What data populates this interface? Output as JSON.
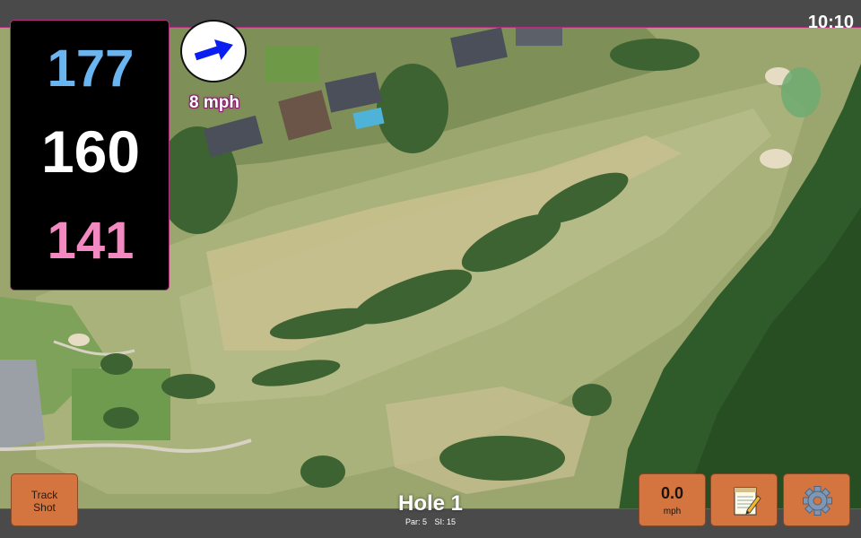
{
  "status": {
    "time": "10:10"
  },
  "distances": {
    "back": "177",
    "center": "160",
    "front": "141"
  },
  "wind": {
    "speed_text": "8 mph",
    "icon": "wind-arrow-icon",
    "arrow_color": "#0a1ef2"
  },
  "hole": {
    "title": "Hole 1",
    "par": "Par: 5",
    "stroke_index": "SI: 15"
  },
  "buttons": {
    "track_shot": {
      "line1": "Track",
      "line2": "Shot"
    },
    "speed": {
      "value": "0.0",
      "unit": "mph"
    },
    "notes": {
      "icon": "notepad-icon"
    },
    "settings": {
      "icon": "gear-icon"
    }
  },
  "colors": {
    "back_distance": "#6ab4f0",
    "center_distance": "#ffffff",
    "front_distance": "#f289c0",
    "button": "#d4743f",
    "accent_border": "#b3307f"
  }
}
